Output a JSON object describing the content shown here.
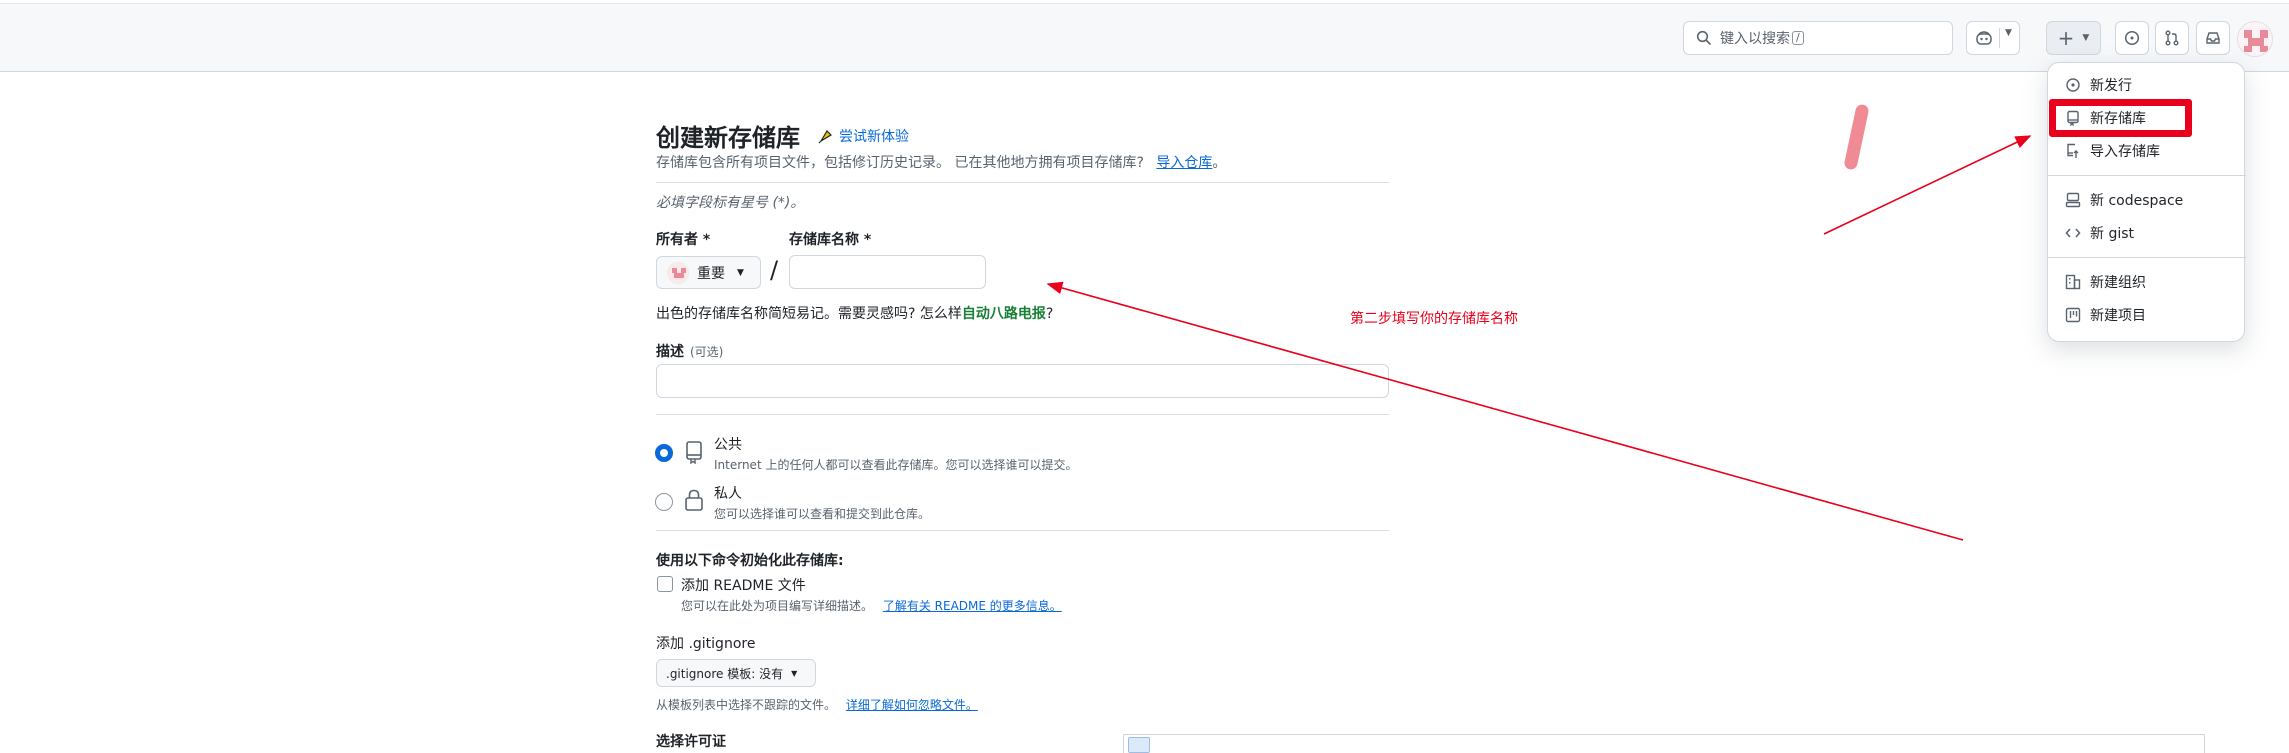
{
  "header": {
    "search_placeholder": "键入以搜索",
    "search_shortcut": "/"
  },
  "page": {
    "title": "创建新存储库",
    "try_new": "尝试新体验",
    "subtitle": "存储库包含所有项目文件，包括修订历史记录。 已在其他地方拥有项目存储库?",
    "import_link": "导入仓库",
    "required_note": "必填字段标有星号 (*)。",
    "owner_label": "所有者 *",
    "owner_value": "重要",
    "repo_name_label": "存储库名称 *",
    "slash": "/",
    "name_hint": "出色的存储库名称简短易记。需要灵感吗? 怎么样",
    "name_suggestion": "自动八路电报",
    "name_hint_end": "?",
    "description_label": "描述",
    "description_optional": "(可选)",
    "visibility": [
      {
        "title": "公共",
        "desc": "Internet 上的任何人都可以查看此存储库。您可以选择谁可以提交。",
        "checked": true
      },
      {
        "title": "私人",
        "desc": "您可以选择谁可以查看和提交到此仓库。",
        "checked": false
      }
    ],
    "init_title": "使用以下命令初始化此存储库:",
    "readme_label": "添加 README 文件",
    "readme_desc": "您可以在此处为项目编写详细描述。",
    "readme_link": "了解有关 README 的更多信息。",
    "gitignore_title": "添加 .gitignore",
    "gitignore_btn": ".gitignore 模板: 没有",
    "gitignore_desc": "从模板列表中选择不跟踪的文件。",
    "gitignore_link": "详细了解如何忽略文件。",
    "license_title": "选择许可证"
  },
  "menu": {
    "items": [
      {
        "label": "新发行",
        "icon": "tag-icon"
      },
      {
        "label": "新存储库",
        "icon": "repo-icon"
      },
      {
        "label": "导入存储库",
        "icon": "repo-push-icon"
      },
      {
        "label": "新 codespace",
        "icon": "codespaces-icon"
      },
      {
        "label": "新 gist",
        "icon": "code-icon"
      },
      {
        "label": "新建组织",
        "icon": "organization-icon"
      },
      {
        "label": "新建项目",
        "icon": "project-icon"
      }
    ]
  },
  "annotation": {
    "text": "第二步填写你的存储库名称",
    "color": "#e8001c"
  }
}
